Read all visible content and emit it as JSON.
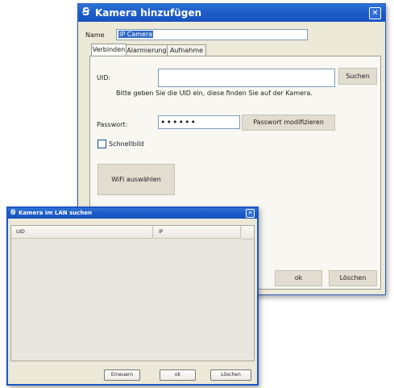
{
  "main_dialog": {
    "title": "Kamera hinzufügen",
    "close": "✕",
    "name_label": "Name",
    "name_value": "IP Camera",
    "tabs": [
      {
        "label": "Verbinden",
        "active": true
      },
      {
        "label": "Alarmierung",
        "active": false
      },
      {
        "label": "Aufnahme",
        "active": false
      }
    ],
    "uid_label": "UID:",
    "uid_value": "",
    "search_button": "Suchen",
    "uid_hint": "Bitte geben Sie die UID ein, diese finden Sie auf der Kamera.",
    "password_label": "Passwort:",
    "password_value": "••••••",
    "modify_password_button": "Passwort modifizieren",
    "snapshot_checkbox_label": "Schnellbild",
    "snapshot_checked": false,
    "wifi_button": "WiFi auswählen",
    "ok_button": "ok",
    "delete_button": "Löschen"
  },
  "lan_dialog": {
    "title": "Kamera im LAN suchen",
    "close": "✕",
    "columns": [
      "UID",
      "IP"
    ],
    "rows": [],
    "refresh_button": "Erneuern",
    "ok_button": "ok",
    "delete_button": "Löschen"
  },
  "colors": {
    "titlebar": "#1d5cc8",
    "dialog_bg": "#ece9d8",
    "selection": "#316ac5"
  }
}
